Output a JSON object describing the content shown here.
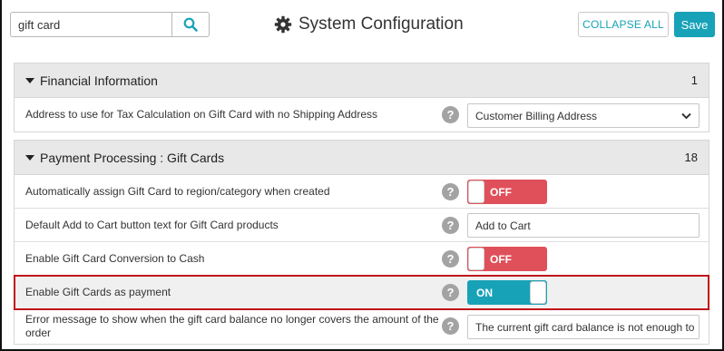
{
  "header": {
    "search": {
      "value": "gift card",
      "icon": "search-icon"
    },
    "title": "System Configuration",
    "title_icon": "gear-icon",
    "collapse_label": "COLLAPSE ALL",
    "save_label": "Save",
    "accent_color": "#17a2b8"
  },
  "sections": [
    {
      "title": "Financial Information",
      "count": "1",
      "rows": [
        {
          "label": "Address to use for Tax Calculation on Gift Card with no Shipping Address",
          "control": "select",
          "value": "Customer Billing Address"
        }
      ]
    },
    {
      "title": "Payment Processing : Gift Cards",
      "count": "18",
      "rows": [
        {
          "label": "Automatically assign Gift Card to region/category when created",
          "control": "toggle",
          "value": "OFF"
        },
        {
          "label": "Default Add to Cart button text for Gift Card products",
          "control": "text",
          "value": "Add to Cart"
        },
        {
          "label": "Enable Gift Card Conversion to Cash",
          "control": "toggle",
          "value": "OFF"
        },
        {
          "label": "Enable Gift Cards as payment",
          "control": "toggle",
          "value": "ON",
          "highlighted": true
        },
        {
          "label": "Error message to show when the gift card balance no longer covers the amount of the order",
          "control": "text",
          "value": "The current gift card balance is not enough to"
        }
      ]
    }
  ],
  "help_glyph": "?",
  "colors": {
    "toggle_off": "#e0505a",
    "toggle_on": "#17a2b8",
    "highlight_border": "#c0141b"
  }
}
